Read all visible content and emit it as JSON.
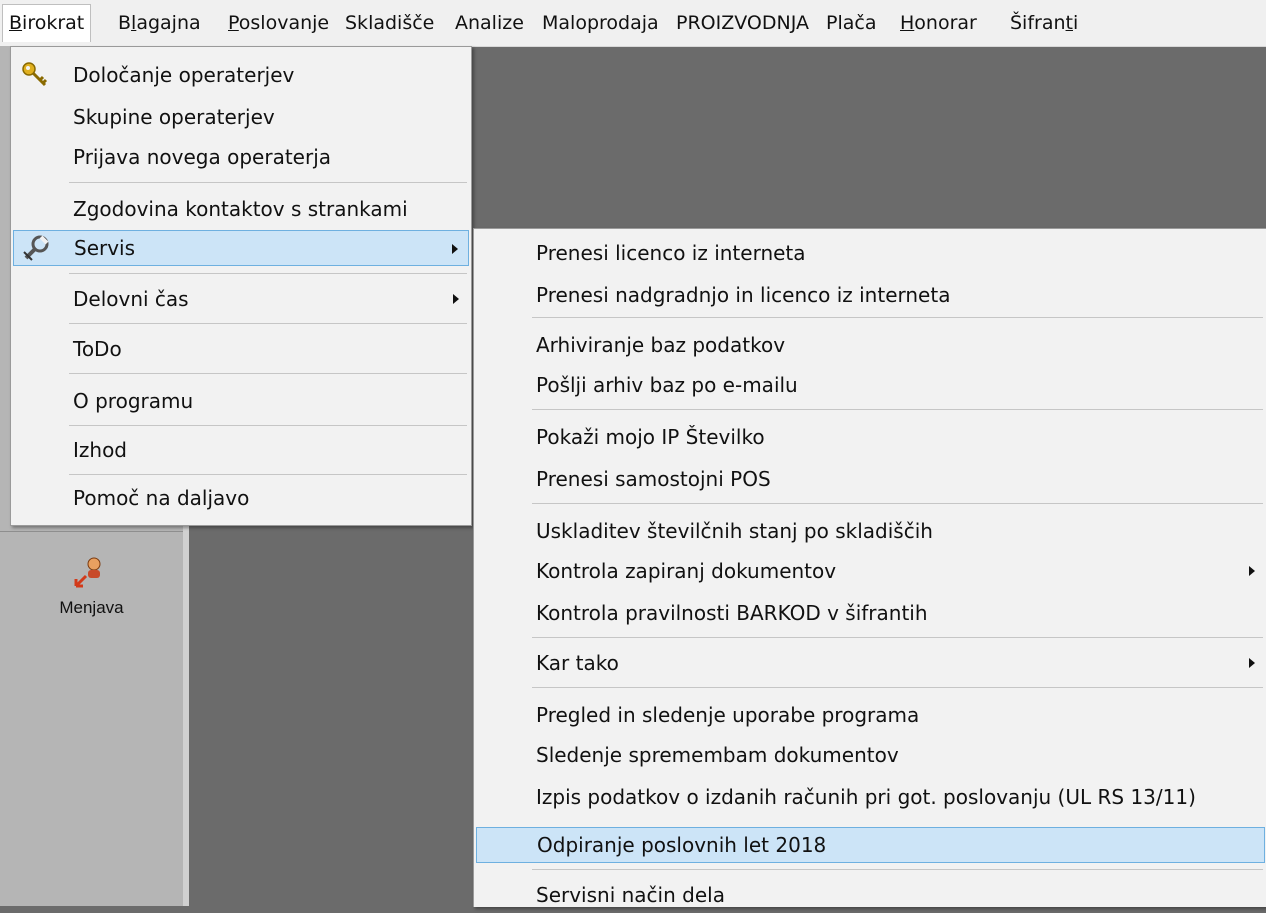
{
  "menubar": {
    "items": [
      {
        "pre": "",
        "u": "B",
        "post": "irokrat"
      },
      {
        "pre": "B",
        "u": "l",
        "post": "agajna"
      },
      {
        "pre": "",
        "u": "P",
        "post": "oslovanje"
      },
      {
        "pre": "Skladišče",
        "u": "",
        "post": ""
      },
      {
        "pre": "Analize",
        "u": "",
        "post": ""
      },
      {
        "pre": "Maloprodaja",
        "u": "",
        "post": ""
      },
      {
        "pre": "PROIZVODNJA",
        "u": "",
        "post": ""
      },
      {
        "pre": "Plača",
        "u": "",
        "post": ""
      },
      {
        "pre": "",
        "u": "H",
        "post": "onorar"
      },
      {
        "pre": "Šifran",
        "u": "t",
        "post": "i"
      }
    ]
  },
  "sidebar": {
    "button_label": "Menjava",
    "button_icon": "user-swap-icon"
  },
  "main_menu": {
    "items": [
      {
        "label": "Določanje operaterjev",
        "icon": "key-icon"
      },
      {
        "label": "Skupine operaterjev"
      },
      {
        "label": "Prijava novega operaterja"
      },
      {
        "label": "Zgodovina kontaktov s strankami"
      },
      {
        "label": "Servis",
        "icon": "wrench-icon",
        "submenu": true,
        "selected": true
      },
      {
        "label": "Delovni čas",
        "submenu": true
      },
      {
        "label": "ToDo"
      },
      {
        "label": "O programu"
      },
      {
        "label": "Izhod"
      },
      {
        "label": "Pomoč na daljavo"
      }
    ]
  },
  "servis_menu": {
    "items": [
      {
        "label": "Prenesi licenco iz interneta"
      },
      {
        "label": "Prenesi nadgradnjo in licenco iz interneta"
      },
      {
        "label": "Arhiviranje baz podatkov"
      },
      {
        "label": "Pošlji arhiv baz po e-mailu"
      },
      {
        "label": "Pokaži mojo IP Številko"
      },
      {
        "label": "Prenesi samostojni POS"
      },
      {
        "label": "Uskladitev številčnih stanj po skladiščih"
      },
      {
        "label": "Kontrola zapiranj dokumentov",
        "submenu": true
      },
      {
        "label": "Kontrola pravilnosti BARKOD v šifrantih"
      },
      {
        "label": "Kar tako",
        "submenu": true
      },
      {
        "label": "Pregled in sledenje uporabe programa"
      },
      {
        "label": "Sledenje spremembam dokumentov"
      },
      {
        "label": "Izpis podatkov o izdanih računih pri got. poslovanju (UL RS 13/11)"
      },
      {
        "label": "Odpiranje poslovnih let 2018",
        "selected": true
      },
      {
        "label": "Servisni način dela"
      }
    ]
  },
  "colors": {
    "selection_bg": "#cce4f7",
    "selection_border": "#6eb0e0",
    "workspace": "#6b6b6b"
  }
}
